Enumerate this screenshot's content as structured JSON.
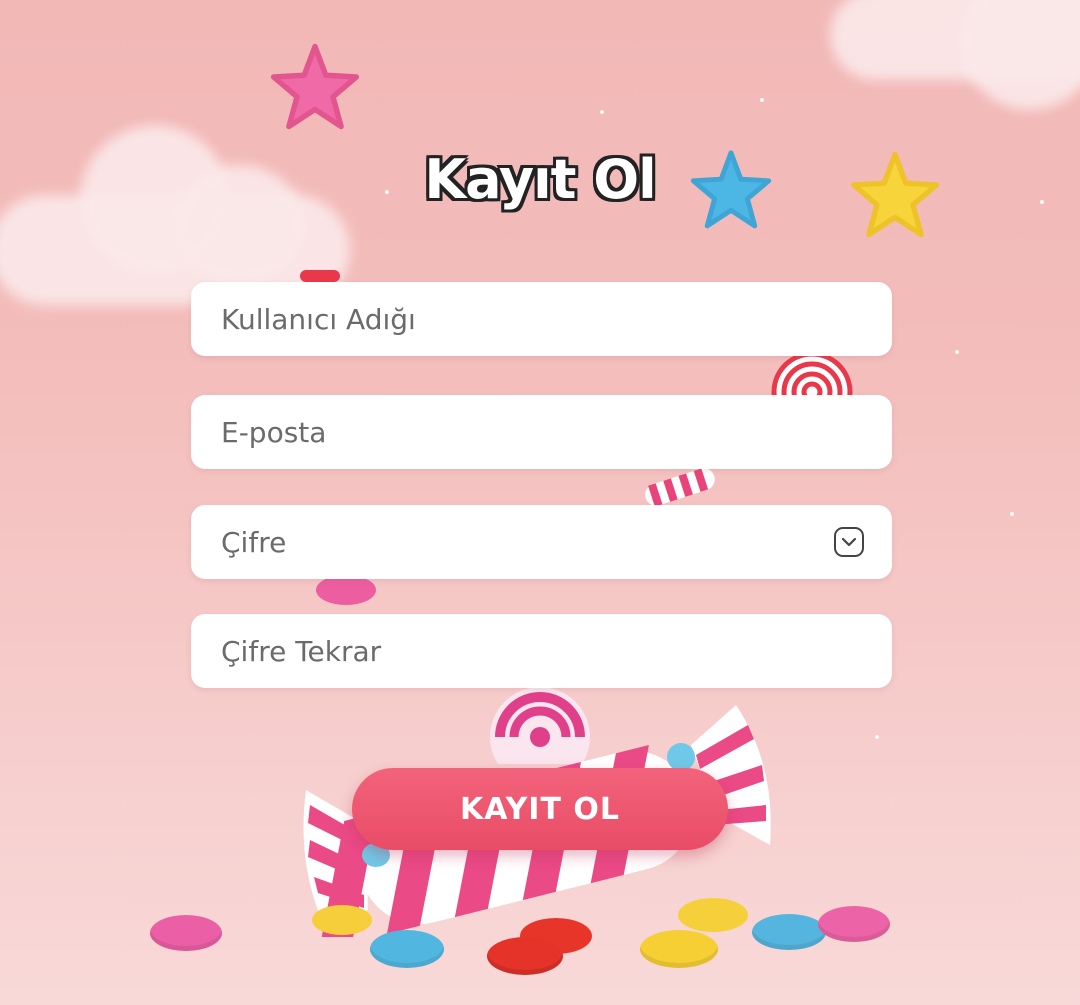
{
  "title": "Kayıt Ol",
  "form": {
    "username_placeholder": "Kullanıcı Adığı",
    "email_placeholder": "E-posta",
    "password_placeholder": "Çifre",
    "password_confirm_placeholder": "Çifre Tekrar",
    "submit_label": "KAYIT OL"
  },
  "colors": {
    "background": "#f1b8b6",
    "button": "#ec5470",
    "input_bg": "#ffffff",
    "title_outline": "#222222"
  },
  "icons": {
    "password_toggle": "eye-toggle-icon"
  }
}
